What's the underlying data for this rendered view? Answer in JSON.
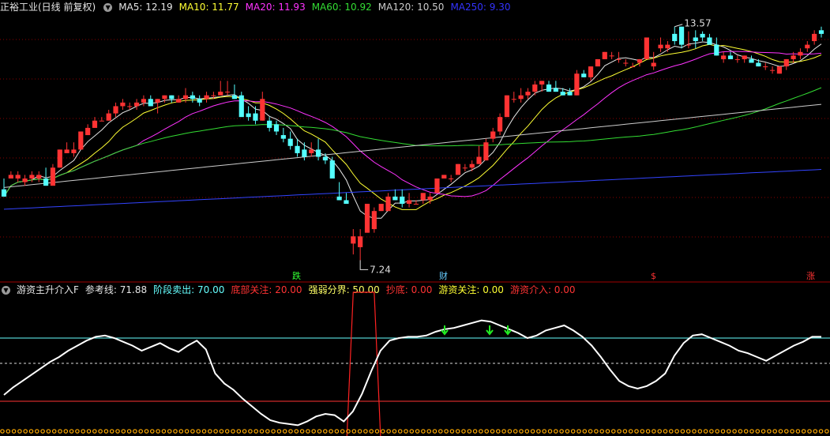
{
  "top_panel": {
    "title": "正裕工业(日线 前复权)",
    "ma_labels": [
      {
        "text": "MA5: 12.19",
        "color": "#e6e6e6"
      },
      {
        "text": "MA10: 11.77",
        "color": "#ffff33"
      },
      {
        "text": "MA20: 11.93",
        "color": "#ff33ff"
      },
      {
        "text": "MA60: 10.92",
        "color": "#33dd33"
      },
      {
        "text": "MA120: 10.50",
        "color": "#cccccc"
      },
      {
        "text": "MA250: 9.30",
        "color": "#3333ff"
      }
    ],
    "high_label": "13.57",
    "low_label": "7.24",
    "events": [
      {
        "text": "跌",
        "color": "#33ff33"
      },
      {
        "text": "财",
        "color": "#66ccff"
      },
      {
        "text": "$",
        "color": "#ff3333"
      },
      {
        "text": "涨",
        "color": "#ff3333"
      }
    ]
  },
  "bottom_panel": {
    "title": "游资主升介入F",
    "params": [
      {
        "text": "参考线: 71.88",
        "color": "#e6e6e6"
      },
      {
        "text": "阶段卖出: 70.00",
        "color": "#66ffff"
      },
      {
        "text": "底部关注: 20.00",
        "color": "#ff3333"
      },
      {
        "text": "强弱分界: 50.00",
        "color": "#ffff66"
      },
      {
        "text": "抄底: 0.00",
        "color": "#ff3333"
      },
      {
        "text": "游资关注: 0.00",
        "color": "#ffff33"
      },
      {
        "text": "游资介入: 0.00",
        "color": "#ff3333"
      }
    ]
  },
  "chart_data": {
    "type": "candlestick",
    "candles": [
      [
        9.2,
        9.5,
        9.0,
        9.0
      ],
      [
        9.5,
        9.7,
        9.5,
        9.6
      ],
      [
        9.5,
        9.7,
        9.4,
        9.6
      ],
      [
        9.4,
        9.6,
        9.3,
        9.5
      ],
      [
        9.5,
        9.7,
        9.4,
        9.6
      ],
      [
        9.5,
        9.7,
        9.4,
        9.6
      ],
      [
        9.5,
        9.8,
        9.3,
        9.3
      ],
      [
        9.3,
        9.9,
        9.3,
        9.8
      ],
      [
        9.8,
        10.3,
        9.8,
        10.3
      ],
      [
        10.2,
        10.5,
        10.2,
        10.3
      ],
      [
        10.2,
        10.5,
        10.1,
        10.3
      ],
      [
        10.3,
        10.8,
        10.3,
        10.8
      ],
      [
        10.7,
        11.0,
        10.7,
        10.9
      ],
      [
        10.9,
        11.2,
        10.9,
        11.1
      ],
      [
        11.1,
        11.2,
        11.1,
        11.1
      ],
      [
        11.1,
        11.4,
        11.1,
        11.3
      ],
      [
        11.3,
        11.6,
        11.2,
        11.5
      ],
      [
        11.5,
        11.7,
        11.4,
        11.6
      ],
      [
        11.5,
        11.6,
        11.4,
        11.5
      ],
      [
        11.5,
        11.7,
        11.4,
        11.6
      ],
      [
        11.6,
        11.8,
        11.5,
        11.7
      ],
      [
        11.7,
        11.8,
        11.5,
        11.5
      ],
      [
        11.6,
        11.7,
        11.3,
        11.7
      ],
      [
        11.7,
        11.8,
        11.6,
        11.8
      ],
      [
        11.8,
        11.8,
        11.6,
        11.7
      ],
      [
        11.6,
        11.8,
        11.6,
        11.7
      ],
      [
        11.7,
        12.0,
        11.6,
        11.8
      ],
      [
        11.8,
        11.9,
        11.6,
        11.7
      ],
      [
        11.7,
        11.8,
        11.5,
        11.6
      ],
      [
        11.7,
        11.9,
        11.6,
        11.8
      ],
      [
        11.8,
        11.9,
        11.7,
        11.8
      ],
      [
        11.8,
        12.2,
        11.8,
        11.9
      ],
      [
        11.9,
        12.2,
        11.8,
        11.9
      ],
      [
        11.8,
        12.1,
        11.7,
        11.7
      ],
      [
        11.8,
        11.9,
        11.4,
        11.2
      ],
      [
        11.3,
        11.5,
        11.1,
        11.2
      ],
      [
        11.3,
        11.5,
        11.0,
        11.1
      ],
      [
        11.1,
        11.9,
        11.1,
        11.7
      ],
      [
        11.1,
        11.2,
        10.8,
        10.9
      ],
      [
        11.0,
        11.1,
        10.7,
        10.8
      ],
      [
        10.7,
        10.9,
        10.5,
        10.6
      ],
      [
        10.6,
        10.8,
        10.3,
        10.4
      ],
      [
        10.4,
        10.6,
        10.1,
        10.2
      ],
      [
        10.3,
        10.5,
        10.0,
        10.1
      ],
      [
        10.2,
        10.5,
        10.1,
        10.3
      ],
      [
        10.3,
        10.6,
        10.0,
        10.1
      ],
      [
        10.1,
        10.2,
        9.9,
        10.0
      ],
      [
        10.0,
        10.1,
        9.5,
        9.5
      ],
      [
        9.0,
        9.4,
        8.9,
        8.9
      ],
      [
        8.9,
        9.1,
        8.8,
        8.8
      ],
      [
        7.7,
        8.1,
        7.4,
        7.9
      ],
      [
        7.6,
        8.1,
        7.24,
        7.9
      ],
      [
        8.0,
        8.8,
        8.0,
        8.8
      ],
      [
        8.1,
        8.7,
        8.0,
        8.6
      ],
      [
        8.6,
        8.8,
        8.6,
        8.8
      ],
      [
        8.6,
        9.1,
        8.6,
        9.0
      ],
      [
        9.0,
        9.2,
        8.9,
        8.9
      ],
      [
        9.0,
        9.2,
        8.7,
        8.8
      ],
      [
        8.8,
        9.1,
        8.7,
        8.9
      ],
      [
        8.8,
        8.9,
        8.8,
        8.8
      ],
      [
        8.9,
        9.1,
        8.8,
        9.1
      ],
      [
        8.9,
        9.1,
        8.8,
        9.0
      ],
      [
        9.1,
        9.5,
        9.1,
        9.5
      ],
      [
        9.5,
        9.6,
        9.5,
        9.6
      ],
      [
        9.5,
        9.6,
        9.4,
        9.5
      ],
      [
        9.6,
        9.9,
        9.6,
        9.9
      ],
      [
        9.8,
        9.9,
        9.7,
        9.8
      ],
      [
        9.8,
        10.0,
        9.7,
        9.9
      ],
      [
        9.9,
        10.4,
        9.9,
        10.1
      ],
      [
        10.0,
        10.6,
        10.0,
        10.5
      ],
      [
        10.6,
        10.9,
        10.5,
        10.8
      ],
      [
        10.8,
        11.3,
        10.7,
        11.2
      ],
      [
        11.2,
        11.8,
        11.2,
        11.8
      ],
      [
        11.7,
        11.9,
        11.6,
        11.7
      ],
      [
        11.7,
        12.0,
        11.6,
        11.8
      ],
      [
        11.8,
        12.0,
        11.7,
        11.9
      ],
      [
        11.9,
        12.2,
        11.8,
        12.1
      ],
      [
        12.1,
        12.2,
        11.9,
        12.2
      ],
      [
        12.1,
        12.2,
        11.9,
        11.9
      ],
      [
        12.0,
        12.2,
        11.9,
        11.9
      ],
      [
        11.9,
        12.0,
        11.8,
        11.8
      ],
      [
        11.9,
        12.0,
        11.8,
        11.8
      ],
      [
        11.8,
        12.5,
        11.8,
        12.4
      ],
      [
        12.4,
        12.5,
        12.3,
        12.3
      ],
      [
        12.3,
        12.6,
        12.2,
        12.6
      ],
      [
        12.6,
        12.8,
        12.6,
        12.8
      ],
      [
        12.8,
        13.0,
        12.8,
        13.0
      ],
      [
        12.9,
        13.0,
        12.8,
        12.9
      ],
      [
        12.8,
        13.0,
        12.7,
        12.8
      ],
      [
        12.7,
        12.8,
        12.6,
        12.7
      ],
      [
        12.6,
        12.7,
        12.6,
        12.6
      ],
      [
        12.7,
        12.8,
        12.6,
        12.8
      ],
      [
        12.8,
        13.0,
        12.8,
        13.4
      ],
      [
        12.6,
        13.0,
        12.5,
        12.7
      ],
      [
        13.1,
        13.4,
        13.0,
        13.2
      ],
      [
        13.1,
        13.3,
        13.0,
        13.2
      ],
      [
        13.5,
        13.7,
        13.2,
        13.3
      ],
      [
        13.7,
        13.7,
        13.1,
        13.2
      ],
      [
        13.2,
        13.57,
        13.1,
        13.2
      ],
      [
        13.4,
        13.6,
        13.1,
        13.3
      ],
      [
        13.5,
        13.57,
        13.3,
        13.4
      ],
      [
        13.4,
        13.5,
        13.2,
        13.2
      ],
      [
        13.2,
        13.4,
        12.9,
        12.9
      ],
      [
        12.8,
        13.0,
        12.7,
        12.9
      ],
      [
        12.9,
        13.0,
        12.8,
        12.8
      ],
      [
        12.8,
        12.9,
        12.7,
        12.8
      ],
      [
        12.8,
        12.9,
        12.7,
        12.9
      ],
      [
        12.8,
        12.9,
        12.7,
        12.7
      ],
      [
        12.7,
        12.8,
        12.6,
        12.6
      ],
      [
        12.6,
        12.7,
        12.5,
        12.6
      ],
      [
        12.5,
        12.6,
        12.4,
        12.5
      ],
      [
        12.4,
        12.6,
        12.4,
        12.6
      ],
      [
        12.6,
        12.8,
        12.5,
        12.8
      ],
      [
        12.8,
        13.0,
        12.7,
        12.9
      ],
      [
        12.9,
        13.1,
        12.8,
        13.0
      ],
      [
        13.1,
        13.3,
        13.0,
        13.2
      ],
      [
        13.3,
        13.6,
        13.2,
        13.5
      ],
      [
        13.6,
        13.7,
        13.4,
        13.5
      ]
    ],
    "oscillator": [
      25,
      31,
      36,
      41,
      46,
      51,
      55,
      60,
      64,
      68,
      71,
      72,
      70,
      67,
      64,
      60,
      63,
      66,
      62,
      59,
      64,
      68,
      61,
      42,
      34,
      29,
      22,
      16,
      10,
      5,
      3,
      2,
      1,
      4,
      8,
      10,
      9,
      4,
      12,
      26,
      44,
      60,
      68,
      70,
      71,
      71,
      72,
      75,
      77,
      78,
      80,
      82,
      84,
      83,
      80,
      77,
      74,
      70,
      72,
      76,
      78,
      80,
      76,
      71,
      64,
      55,
      45,
      36,
      32,
      30,
      32,
      36,
      42,
      56,
      66,
      72,
      73,
      70,
      67,
      64,
      60,
      58,
      55,
      52,
      56,
      60,
      64,
      67,
      71,
      71
    ],
    "ref_lines": [
      70,
      50,
      20
    ],
    "ylim_osc": [
      0,
      100
    ]
  }
}
